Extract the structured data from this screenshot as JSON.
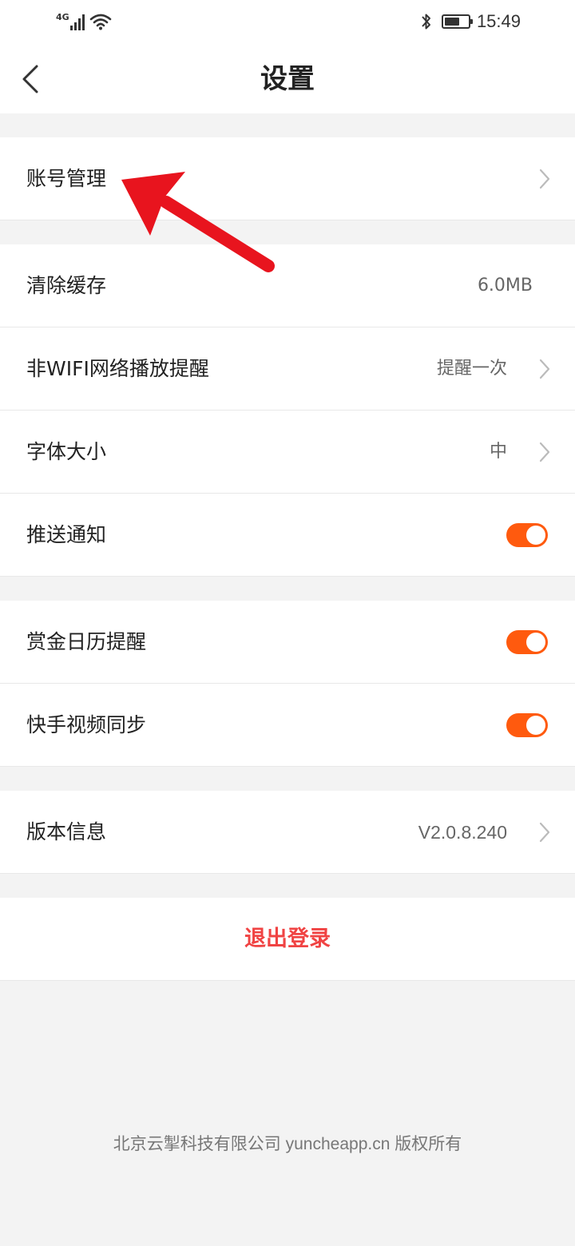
{
  "status_bar": {
    "network": "4G",
    "time": "15:49",
    "icons": [
      "signal-icon",
      "wifi-icon",
      "bluetooth-icon",
      "battery-icon"
    ]
  },
  "nav": {
    "title": "设置",
    "back_icon": "chevron-left-icon"
  },
  "group1": {
    "account": {
      "label": "账号管理"
    }
  },
  "group2": {
    "clear_cache": {
      "label": "清除缓存",
      "value": "6.0MB"
    },
    "non_wifi": {
      "label": "非WIFI网络播放提醒",
      "value": "提醒一次"
    },
    "font_size": {
      "label": "字体大小",
      "value": "中"
    },
    "push": {
      "label": "推送通知",
      "enabled": true
    }
  },
  "group3": {
    "bounty_calendar": {
      "label": "赏金日历提醒",
      "enabled": true
    },
    "kuaishou_sync": {
      "label": "快手视频同步",
      "enabled": true
    }
  },
  "group4": {
    "version": {
      "label": "版本信息",
      "value": "V2.0.8.240"
    }
  },
  "logout": {
    "label": "退出登录"
  },
  "footer": {
    "text": "北京云掣科技有限公司 yuncheapp.cn 版权所有"
  },
  "colors": {
    "accent": "#ff5a0e",
    "logout": "#f04343",
    "annotation_arrow": "#e8141e",
    "background": "#f3f3f3"
  }
}
